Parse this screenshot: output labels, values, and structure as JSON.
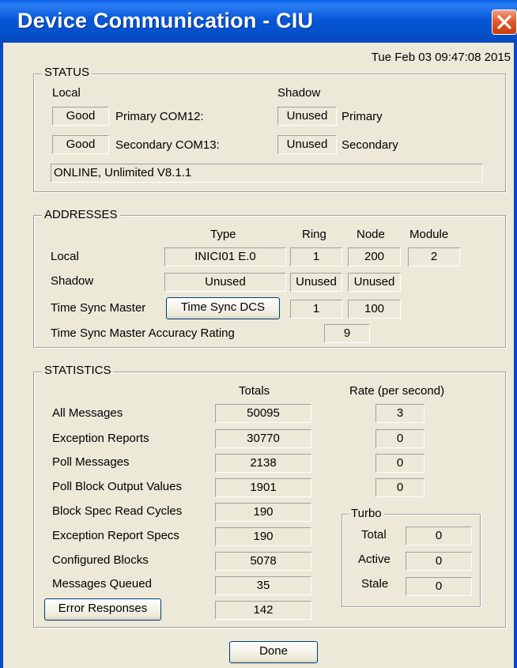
{
  "window": {
    "title": "Device Communication - CIU",
    "datetime": "Tue Feb 03 09:47:08 2015"
  },
  "status": {
    "group_title": "STATUS",
    "local_header": "Local",
    "shadow_header": "Shadow",
    "primary": {
      "local_value": "Good",
      "local_label": "Primary COM12:",
      "shadow_value": "Unused",
      "shadow_label": "Primary"
    },
    "secondary": {
      "local_value": "Good",
      "local_label": "Secondary COM13:",
      "shadow_value": "Unused",
      "shadow_label": "Secondary"
    },
    "message": "ONLINE, Unlimited V8.1.1"
  },
  "addresses": {
    "group_title": "ADDRESSES",
    "headers": {
      "type": "Type",
      "ring": "Ring",
      "node": "Node",
      "module": "Module"
    },
    "local": {
      "label": "Local",
      "type": "INICI01 E.0",
      "ring": "1",
      "node": "200",
      "module": "2"
    },
    "shadow": {
      "label": "Shadow",
      "type": "Unused",
      "ring": "Unused",
      "node": "Unused"
    },
    "time_sync": {
      "label": "Time Sync Master",
      "button": "Time Sync DCS",
      "ring": "1",
      "node": "100"
    },
    "accuracy": {
      "label": "Time Sync Master Accuracy Rating",
      "value": "9"
    }
  },
  "statistics": {
    "group_title": "STATISTICS",
    "totals_header": "Totals",
    "rate_header": "Rate (per second)",
    "rows": [
      {
        "label": "All Messages",
        "total": "50095",
        "rate": "3"
      },
      {
        "label": "Exception Reports",
        "total": "30770",
        "rate": "0"
      },
      {
        "label": "Poll Messages",
        "total": "2138",
        "rate": "0"
      },
      {
        "label": "Poll Block Output Values",
        "total": "1901",
        "rate": "0"
      },
      {
        "label": "Block Spec Read Cycles",
        "total": "190"
      },
      {
        "label": "Exception Report Specs",
        "total": "190"
      },
      {
        "label": "Configured Blocks",
        "total": "5078"
      },
      {
        "label": "Messages Queued",
        "total": "35"
      }
    ],
    "error_responses": {
      "button": "Error Responses",
      "total": "142"
    },
    "turbo": {
      "group_title": "Turbo",
      "total": {
        "label": "Total",
        "value": "0"
      },
      "active": {
        "label": "Active",
        "value": "0"
      },
      "stale": {
        "label": "Stale",
        "value": "0"
      }
    }
  },
  "done_button": "Done",
  "icons": {
    "close": "close-icon"
  },
  "colors": {
    "titlebar": "#0757d8",
    "close_button": "#e25c2e",
    "dialog_bg": "#ece9d8"
  }
}
